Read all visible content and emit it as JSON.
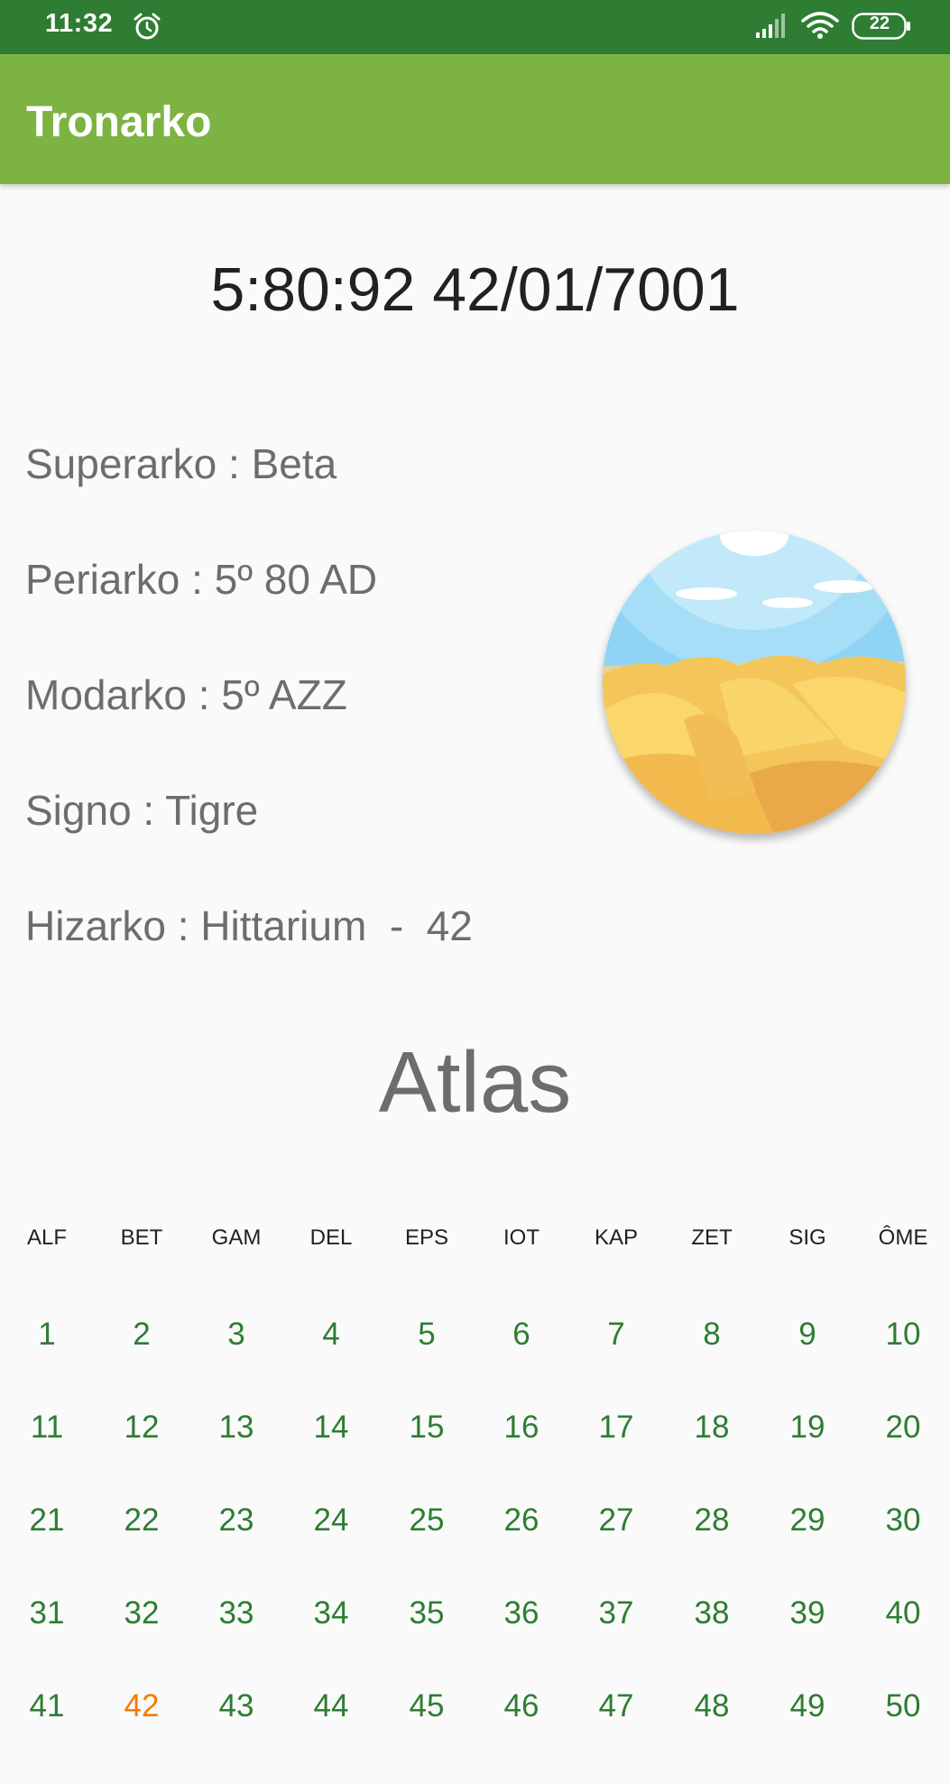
{
  "status_bar": {
    "time": "11:32",
    "battery": "22",
    "icons": [
      "alarm-icon",
      "signal-icon",
      "wifi-icon",
      "battery-icon"
    ]
  },
  "app_bar": {
    "title": "Tronarko",
    "color": "#7cb342"
  },
  "datetime": "5:80:92 42/01/7001",
  "info": {
    "superarko": "Superarko : Beta",
    "periarko": "Periarko : 5º 80 AD",
    "modarko": "Modarko : 5º AZZ",
    "signo": "Signo : Tigre",
    "hizarko": "Hizarko : Hittarium  -  42"
  },
  "image_icon": "desert-landscape-icon",
  "atlas": {
    "title": "Atlas",
    "weekdays": [
      "ALF",
      "BET",
      "GAM",
      "DEL",
      "EPS",
      "IOT",
      "KAP",
      "ZET",
      "SIG",
      "ÔME"
    ],
    "weeks": [
      [
        "1",
        "2",
        "3",
        "4",
        "5",
        "6",
        "7",
        "8",
        "9",
        "10"
      ],
      [
        "11",
        "12",
        "13",
        "14",
        "15",
        "16",
        "17",
        "18",
        "19",
        "20"
      ],
      [
        "21",
        "22",
        "23",
        "24",
        "25",
        "26",
        "27",
        "28",
        "29",
        "30"
      ],
      [
        "31",
        "32",
        "33",
        "34",
        "35",
        "36",
        "37",
        "38",
        "39",
        "40"
      ],
      [
        "41",
        "42",
        "43",
        "44",
        "45",
        "46",
        "47",
        "48",
        "49",
        "50"
      ]
    ],
    "current_day": "42",
    "day_color": "#2e7d32",
    "current_day_color": "#f57c00"
  }
}
